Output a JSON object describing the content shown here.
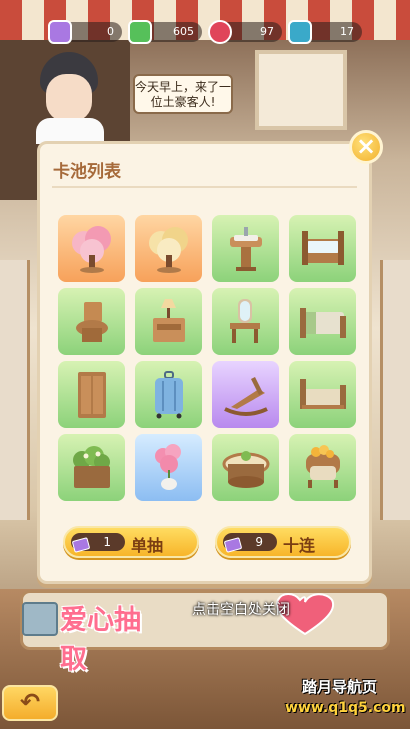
{
  "resources": [
    {
      "name": "ticket",
      "value": "0",
      "color": "#a978e2"
    },
    {
      "name": "cash",
      "value": "605",
      "color": "#56c05a"
    },
    {
      "name": "heart",
      "value": "97",
      "color": "#e0455a"
    },
    {
      "name": "gem",
      "value": "17",
      "color": "#3aa9c9"
    }
  ],
  "npc_speech": "今天早上，来了一位土豪客人!",
  "modal": {
    "title": "卡池列表",
    "close_label": "×"
  },
  "items": [
    {
      "name": "pink-blossom-tree",
      "bg": "orange"
    },
    {
      "name": "golden-tree",
      "bg": "orange"
    },
    {
      "name": "pedestal-sink",
      "bg": "green"
    },
    {
      "name": "bathtub",
      "bg": "green"
    },
    {
      "name": "wooden-toilet",
      "bg": "green"
    },
    {
      "name": "nightstand-lamp",
      "bg": "green"
    },
    {
      "name": "vanity-mirror",
      "bg": "green"
    },
    {
      "name": "single-bed",
      "bg": "green"
    },
    {
      "name": "wardrobe",
      "bg": "green"
    },
    {
      "name": "suitcase",
      "bg": "green"
    },
    {
      "name": "rocking-chair",
      "bg": "purple"
    },
    {
      "name": "wooden-bed",
      "bg": "green"
    },
    {
      "name": "flower-planter",
      "bg": "green"
    },
    {
      "name": "pink-flower-pot",
      "bg": "blue"
    },
    {
      "name": "round-table",
      "bg": "green"
    },
    {
      "name": "flower-armchair",
      "bg": "green"
    }
  ],
  "draw_single": {
    "cost": "1",
    "label": "单抽"
  },
  "draw_ten": {
    "cost": "9",
    "label": "十连"
  },
  "close_hint": "点击空白处关闭",
  "banner_text": "爱心抽取",
  "back_icon": "↶",
  "watermark": {
    "line1": "踏月导航页",
    "line2": "www.q1q5.com"
  }
}
